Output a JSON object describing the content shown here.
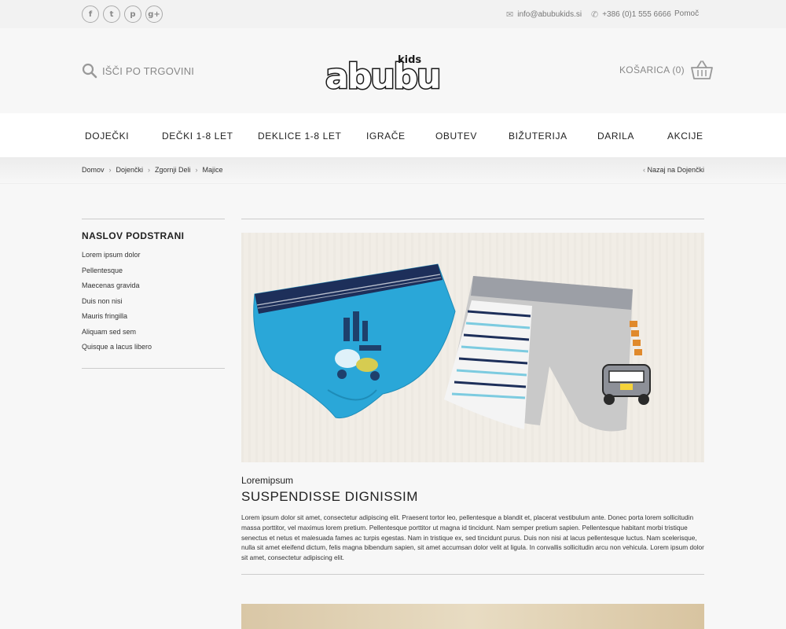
{
  "topbar": {
    "social": [
      {
        "icon": "facebook-icon",
        "glyph": "f"
      },
      {
        "icon": "twitter-icon",
        "glyph": "t"
      },
      {
        "icon": "pinterest-icon",
        "glyph": "p"
      },
      {
        "icon": "google-plus-icon",
        "glyph": "g+"
      }
    ],
    "email": "info@abubukids.si",
    "phone": "+386 (0)1 555 6666",
    "help": "Pomoč"
  },
  "header": {
    "search_label": "IŠČI PO TRGOVINI",
    "logo_main": "abubu",
    "logo_kids": "kids",
    "cart_label": "KOŠARICA (0)"
  },
  "nav": [
    "DOJEČKI",
    "DEČKI 1-8 LET",
    "DEKLICE 1-8 LET",
    "IGRAČE",
    "OBUTEV",
    "BIŽUTERIJA",
    "DARILA",
    "AKCIJE"
  ],
  "breadcrumb": {
    "items": [
      "Domov",
      "Dojenčki",
      "Zgornji Deli",
      "Majice"
    ],
    "back": "Nazaj na Dojenčki"
  },
  "sidebar": {
    "title": "NASLOV PODSTRANI",
    "links": [
      "Lorem ipsum dolor",
      "Pellentesque",
      "Maecenas gravida",
      "Duis non nisi",
      "Mauris fringilla",
      "Aliquam sed sem",
      "Quisque a lacus libero"
    ]
  },
  "article": {
    "subtitle": "Loremipsum",
    "title": "SUSPENDISSE DIGNISSIM",
    "body": "Lorem ipsum dolor sit amet, consectetur adipiscing elit. Praesent tortor leo, pellentesque a blandit et, placerat vestibulum ante. Donec porta lorem sollicitudin massa porttitor, vel maximus lorem pretium. Pellentesque porttitor ut magna id tincidunt. Nam semper pretium sapien. Pellentesque habitant morbi tristique senectus et netus et malesuada fames ac turpis egestas. Nam in tristique ex, sed tincidunt purus. Duis non nisi at lacus pellentesque luctus. Nam scelerisque, nulla sit amet eleifend dictum, felis magna bibendum sapien, sit amet accumsan dolor velit at ligula. In convallis sollicitudin arcu non vehicula. Lorem ipsum dolor sit amet, consectetur adipiscing elit."
  },
  "colors": {
    "background": "#f7f7f7",
    "nav_bg": "#ffffff",
    "text": "#222222",
    "brief_blue": "#2aa7d8",
    "brief_band": "#1d2f5a",
    "boxer_grey": "#c9c9c9"
  }
}
